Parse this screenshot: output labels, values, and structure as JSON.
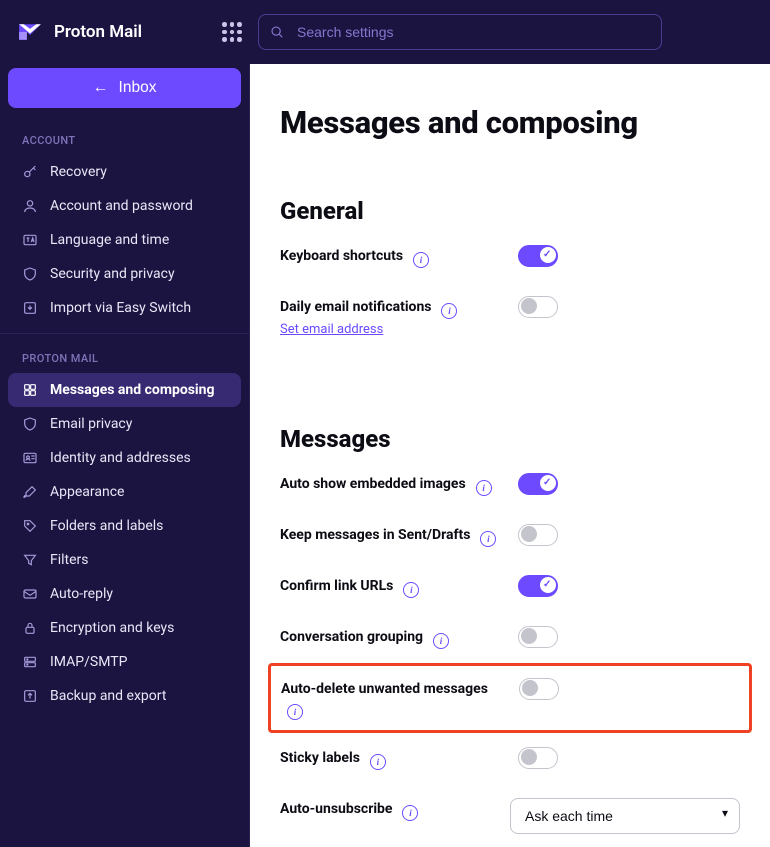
{
  "brand": "Proton Mail",
  "search": {
    "placeholder": "Search settings"
  },
  "inbox_button": "Inbox",
  "sidebar": {
    "section_account": "ACCOUNT",
    "section_proton_mail": "PROTON MAIL",
    "account_items": [
      {
        "label": "Recovery"
      },
      {
        "label": "Account and password"
      },
      {
        "label": "Language and time"
      },
      {
        "label": "Security and privacy"
      },
      {
        "label": "Import via Easy Switch"
      }
    ],
    "mail_items": [
      {
        "label": "Messages and composing"
      },
      {
        "label": "Email privacy"
      },
      {
        "label": "Identity and addresses"
      },
      {
        "label": "Appearance"
      },
      {
        "label": "Folders and labels"
      },
      {
        "label": "Filters"
      },
      {
        "label": "Auto-reply"
      },
      {
        "label": "Encryption and keys"
      },
      {
        "label": "IMAP/SMTP"
      },
      {
        "label": "Backup and export"
      }
    ]
  },
  "page": {
    "title": "Messages and composing",
    "general_title": "General",
    "messages_title": "Messages",
    "settings": {
      "keyboard_shortcuts": {
        "label": "Keyboard shortcuts",
        "on": true
      },
      "daily_email": {
        "label": "Daily email notifications",
        "sublink": "Set email address",
        "on": false
      },
      "auto_show_images": {
        "label": "Auto show embedded images",
        "on": true
      },
      "keep_sent": {
        "label": "Keep messages in Sent/Drafts",
        "on": false
      },
      "confirm_urls": {
        "label": "Confirm link URLs",
        "on": true
      },
      "conversation_grouping": {
        "label": "Conversation grouping",
        "on": false
      },
      "auto_delete": {
        "label": "Auto-delete unwanted messages",
        "on": false
      },
      "sticky_labels": {
        "label": "Sticky labels",
        "on": false
      },
      "auto_unsubscribe": {
        "label": "Auto-unsubscribe",
        "value": "Ask each time"
      }
    }
  }
}
